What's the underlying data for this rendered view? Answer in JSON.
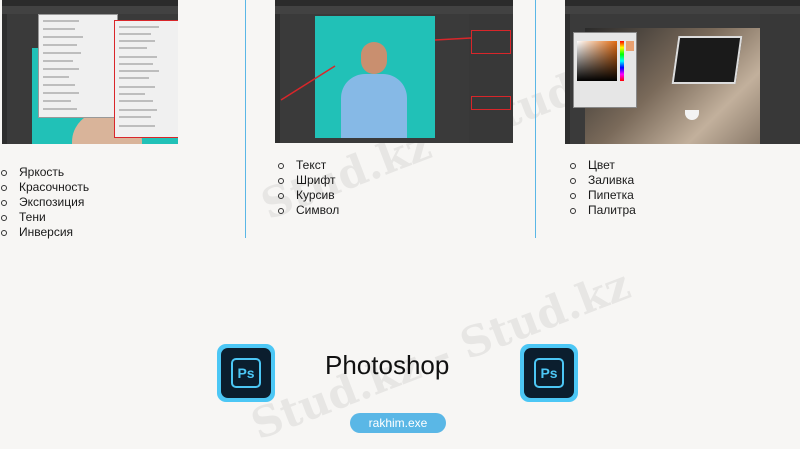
{
  "slide_title": "Photoshop",
  "author_tag": "rakhim.exe",
  "watermark_text": "Stud.kz - Stud.kz",
  "columns": [
    {
      "items": [
        "Яркость",
        "Красочность",
        "Экспозиция",
        "Тени",
        "Инверсия"
      ]
    },
    {
      "items": [
        "Текст",
        "Шрифт",
        "Курсив",
        "Символ"
      ]
    },
    {
      "items": [
        "Цвет",
        "Заливка",
        "Пипетка",
        "Палитра"
      ]
    }
  ],
  "logo_text": "Ps",
  "colors": {
    "accent": "#5ab7e6",
    "ps_blue": "#4cc7f5",
    "ps_dark": "#0b1e2e",
    "canvas_teal": "#21c1b7"
  }
}
